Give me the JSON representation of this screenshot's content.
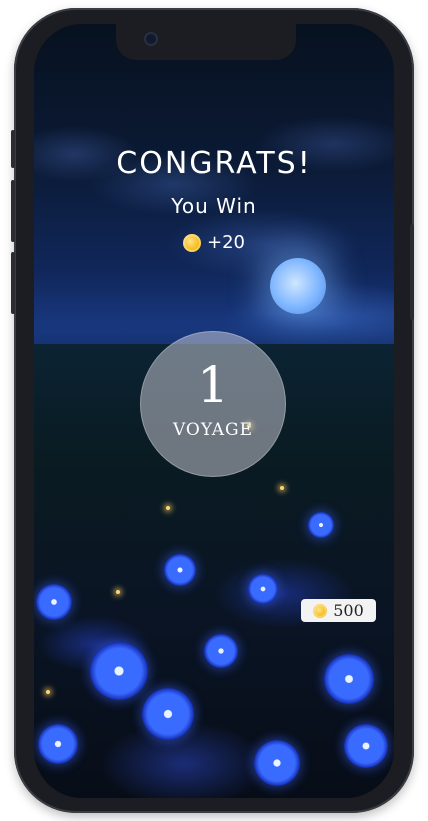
{
  "result": {
    "headline": "CONGRATS!",
    "subtitle": "You Win",
    "reward_amount": "+20",
    "reward_icon": "coin-icon"
  },
  "level": {
    "number": "1",
    "label": "VOYAGE"
  },
  "wallet": {
    "icon": "coin-icon",
    "balance": "500"
  },
  "colors": {
    "coin": "#f3b300",
    "text": "#ffffff",
    "badge_bg": "#f3f3f3"
  }
}
